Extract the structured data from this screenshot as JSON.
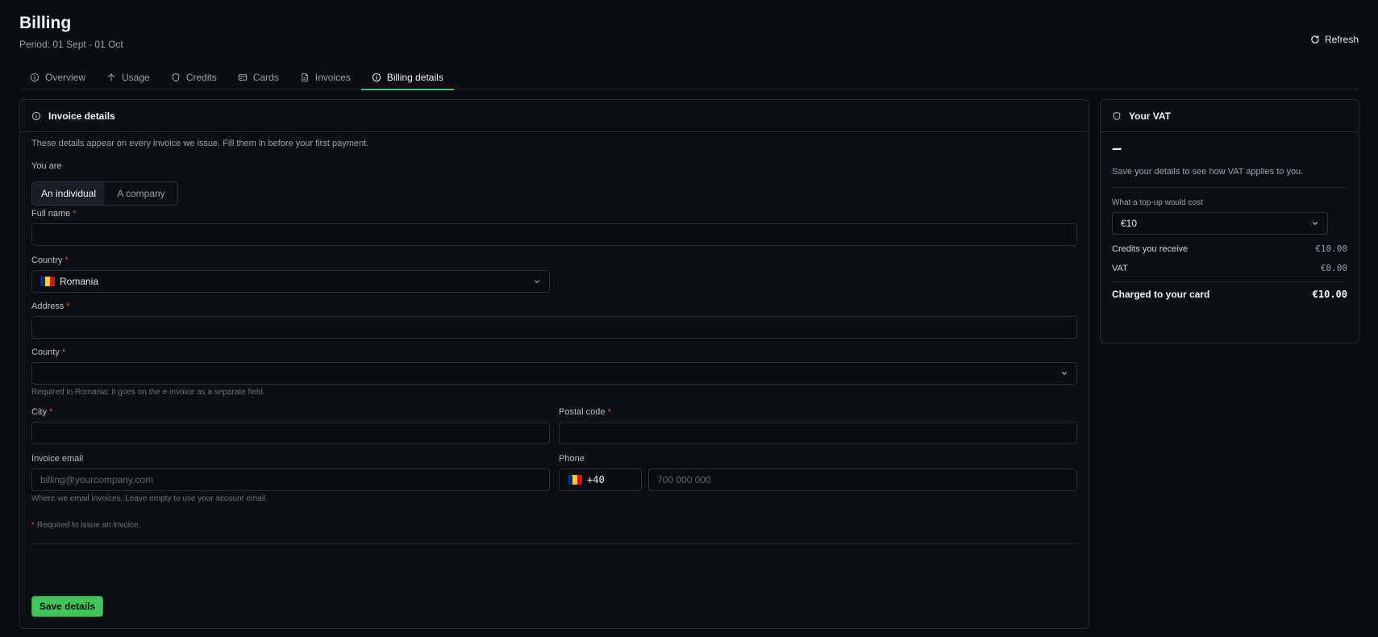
{
  "header": {
    "title": "Billing",
    "period": "Period: 01 Sept - 01 Oct",
    "refresh_label": "Refresh"
  },
  "tabs": [
    {
      "label": "Overview",
      "icon": "info-icon"
    },
    {
      "label": "Usage",
      "icon": "arrow-up-icon"
    },
    {
      "label": "Credits",
      "icon": "shield-icon"
    },
    {
      "label": "Cards",
      "icon": "credit-card-icon"
    },
    {
      "label": "Invoices",
      "icon": "document-icon"
    },
    {
      "label": "Billing details",
      "icon": "info-icon",
      "active": true
    }
  ],
  "invoice_details": {
    "title": "Invoice details",
    "intro": "These details appear on every invoice we issue. Fill them in before your first payment.",
    "you_are_label": "You are",
    "type_options": [
      "An individual",
      "A company"
    ],
    "selected_type": "An individual",
    "full_name": {
      "label": "Full name",
      "value": ""
    },
    "country": {
      "label": "Country",
      "value": "Romania"
    },
    "address": {
      "label": "Address",
      "value": ""
    },
    "county": {
      "label": "County",
      "value": "",
      "hint": "Required in Romania: it goes on the e-invoice as a separate field."
    },
    "city": {
      "label": "City",
      "value": ""
    },
    "postal_code": {
      "label": "Postal code",
      "value": ""
    },
    "invoice_email": {
      "label": "Invoice email",
      "placeholder": "billing@yourcompany.com",
      "hint": "Where we email invoices. Leave empty to use your account email."
    },
    "phone": {
      "label": "Phone",
      "prefix": "+40",
      "placeholder": "700 000 000"
    },
    "required_marker": "*",
    "required_note": "Required to issue an invoice.",
    "save_label": "Save details"
  },
  "vat": {
    "title": "Your VAT",
    "rate_display": "–",
    "note": "Save your details to see how VAT applies to you.",
    "topup_label": "What a top-up would cost",
    "topup_value": "€10",
    "credits_label": "Credits you receive",
    "credits_value": "€10.00",
    "vat_label": "VAT",
    "vat_value": "€0.00",
    "charged_label": "Charged to your card",
    "charged_value": "€10.00"
  },
  "colors": {
    "accent": "#3fc55a",
    "required": "#ef4444",
    "romania_flag": [
      "#002b7f",
      "#fcd116",
      "#ce1126"
    ]
  }
}
